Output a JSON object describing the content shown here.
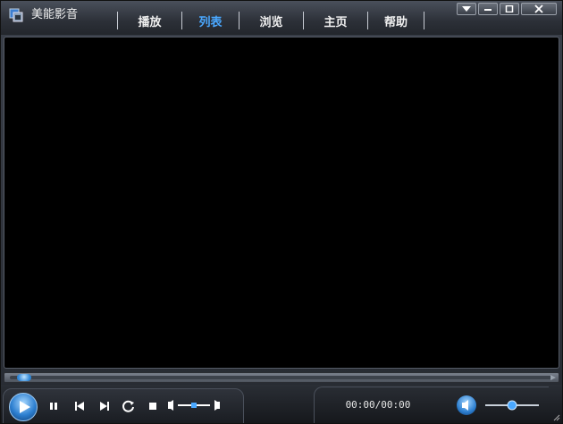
{
  "app": {
    "title": "美能影音",
    "icon": "player-icon"
  },
  "tabs": [
    {
      "label": "播放",
      "active": false
    },
    {
      "label": "列表",
      "active": true
    },
    {
      "label": "浏览",
      "active": false
    },
    {
      "label": "主页",
      "active": false
    },
    {
      "label": "帮助",
      "active": false
    }
  ],
  "window_buttons": [
    "menu-dropdown-icon",
    "minimize-icon",
    "maximize-icon",
    "close-icon"
  ],
  "playback": {
    "time": "00:00/00:00",
    "progress": 0,
    "volume": 0.5,
    "balance": 0.5
  },
  "colors": {
    "accent": "#4aa8ff",
    "video_bg": "#000000"
  }
}
